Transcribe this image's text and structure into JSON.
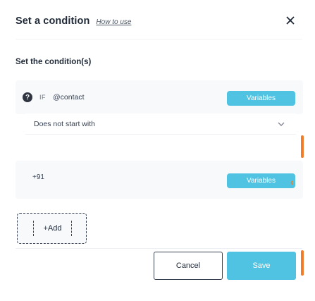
{
  "header": {
    "title": "Set a condition",
    "how_to_use": "How to use",
    "close_icon": "close-icon"
  },
  "section": {
    "title": "Set the condition(s)"
  },
  "condition": {
    "help_icon_glyph": "?",
    "if_label": "IF",
    "contact_label": "@contact",
    "variables_label": "Variables",
    "operator_value": "Does not start with",
    "compare_value": "+91",
    "variables_label_2": "Variables"
  },
  "add": {
    "label": "+Add"
  },
  "footer": {
    "cancel_label": "Cancel",
    "save_label": "Save"
  },
  "colors": {
    "accent": "#4fc3e1",
    "highlight": "#f07d2c",
    "panel_bg": "#f7f9fb",
    "text": "#1f2937"
  }
}
